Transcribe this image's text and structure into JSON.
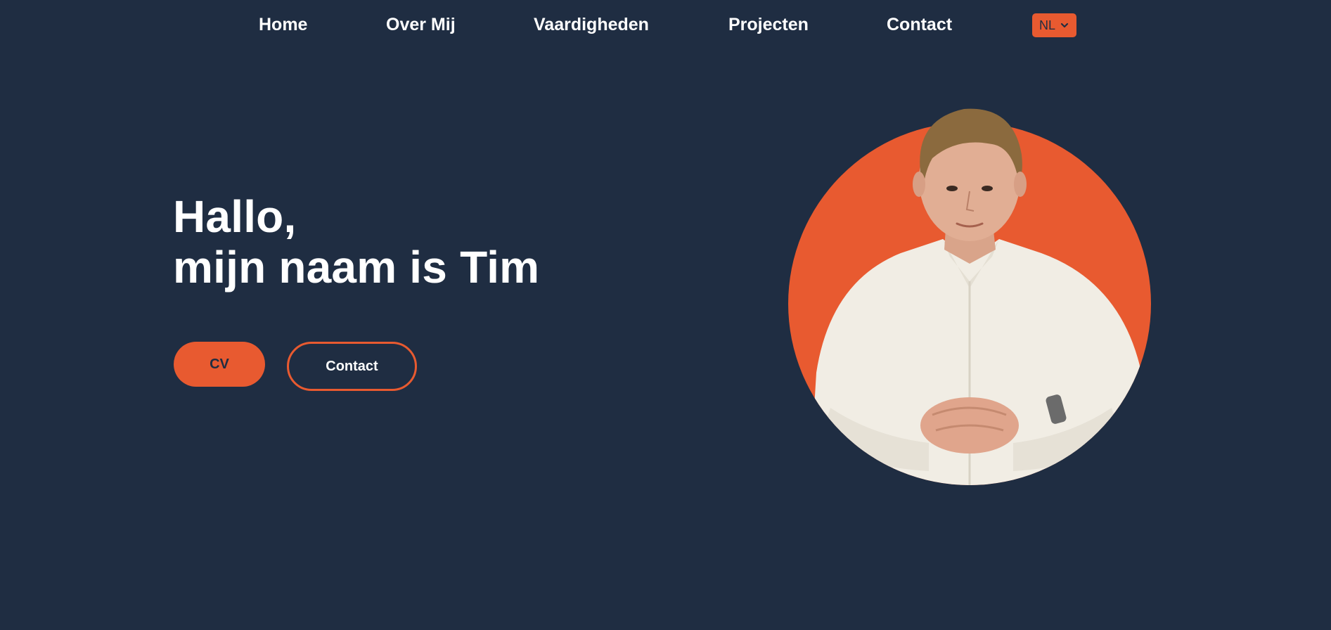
{
  "nav": {
    "items": [
      {
        "label": "Home"
      },
      {
        "label": "Over Mij"
      },
      {
        "label": "Vaardigheden"
      },
      {
        "label": "Projecten"
      },
      {
        "label": "Contact"
      }
    ],
    "language": {
      "selected": "NL",
      "icon": "chevron-down-icon"
    }
  },
  "hero": {
    "greeting": "Hallo,",
    "name_line": "mijn naam is Tim",
    "buttons": {
      "cv_label": "CV",
      "contact_label": "Contact"
    }
  },
  "colors": {
    "background": "#1f2d42",
    "accent": "#e85a30",
    "text": "#ffffff"
  }
}
